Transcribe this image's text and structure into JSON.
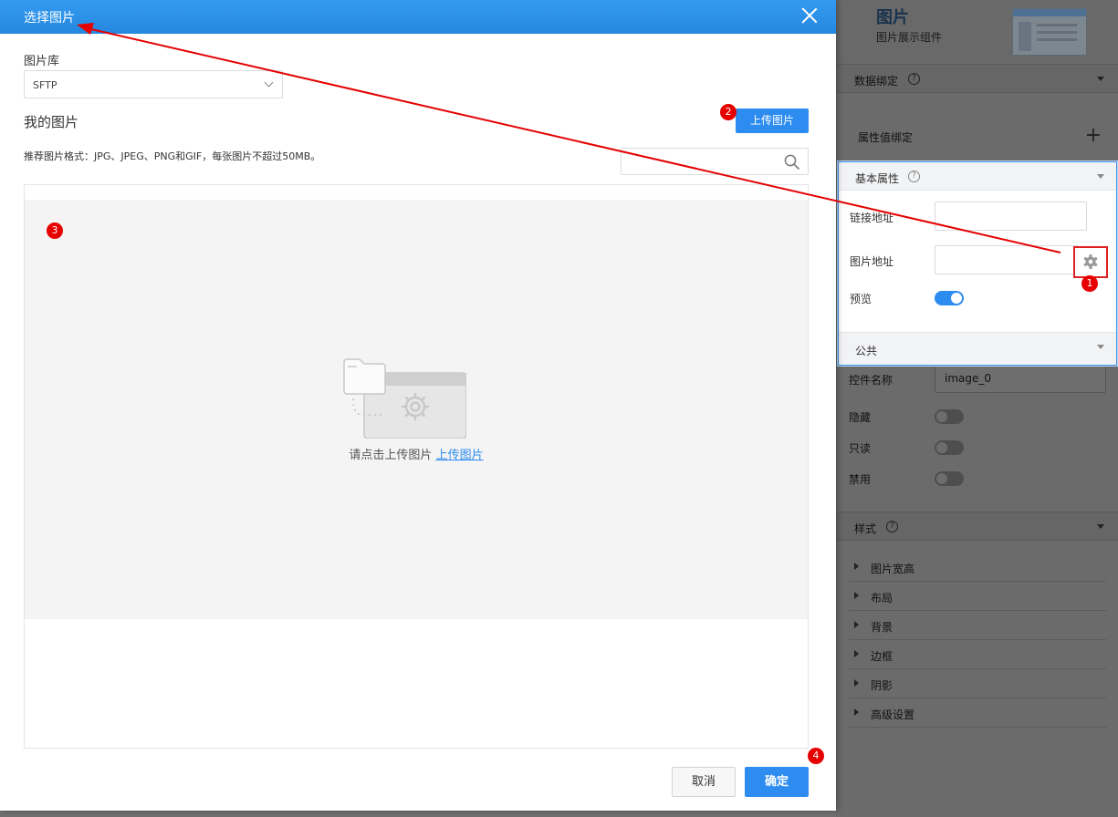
{
  "right_panel": {
    "title": "图片",
    "subtitle": "图片展示组件",
    "data_binding_label": "数据绑定",
    "attr_binding_label": "属性值绑定",
    "basic_props_label": "基本属性",
    "link_label": "链接地址",
    "image_url_label": "图片地址",
    "preview_label": "预览",
    "public_label": "公共",
    "control_name_label": "控件名称",
    "control_name_value": "image_0",
    "hidden_label": "隐藏",
    "readonly_label": "只读",
    "disabled_label": "禁用",
    "style_label": "样式",
    "style_items": [
      "图片宽高",
      "布局",
      "背景",
      "边框",
      "阴影",
      "高级设置"
    ],
    "help_glyph": "?",
    "plus_glyph": "+"
  },
  "dialog": {
    "title": "选择图片",
    "library_label": "图片库",
    "library_value": "SFTP",
    "my_images_title": "我的图片",
    "upload_button": "上传图片",
    "hint_text": "推荐图片格式：JPG、JPEG、PNG和GIF，每张图片不超过50MB。",
    "search_placeholder": "",
    "empty_text": "请点击上传图片",
    "empty_link": "上传图片",
    "cancel_button": "取消",
    "ok_button": "确定"
  },
  "markers": [
    "1",
    "2",
    "3",
    "4"
  ],
  "colors": {
    "accent": "#2d8cf0",
    "header": "#2d8fe6",
    "annotation": "#e60000"
  },
  "icons": [
    "close-icon",
    "chevron-down-icon",
    "search-icon",
    "folder-gear-icon",
    "gear-icon",
    "help-icon",
    "plus-icon"
  ]
}
